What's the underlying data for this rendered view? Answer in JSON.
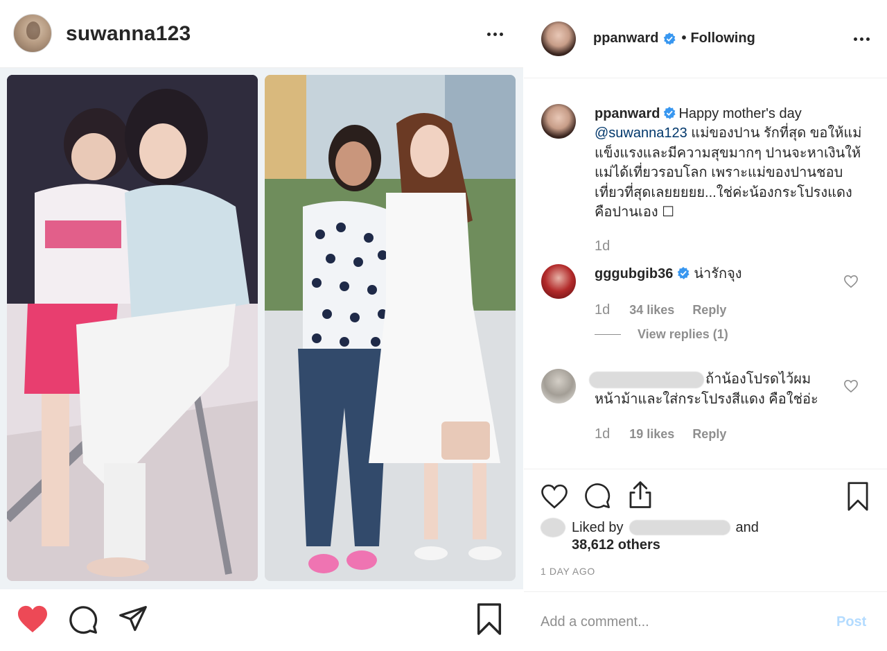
{
  "left_post": {
    "username": "suwanna123",
    "more_label": "More options"
  },
  "right_panel": {
    "header": {
      "username": "ppanward",
      "separator": "•",
      "follow_status": "Following"
    },
    "caption": {
      "username": "ppanward",
      "text_start": "Happy mother's day",
      "mention": "@suwanna123",
      "text_rest": "แม่ของปาน รักที่สุด ขอให้แม่แข็งแรงและมีความสุขมากๆ ปานจะหาเงินให้แม่ได้เที่ยวรอบโลก เพราะแม่ของปานชอบเที่ยวที่สุดเลยยยยย...ใช่ค่ะน้องกระโปรงแดงคือปานเอง ☐",
      "time": "1d"
    },
    "comments": [
      {
        "username": "gggubgib36",
        "text": "น่ารักจุง",
        "time": "1d",
        "likes": "34 likes",
        "reply": "Reply",
        "view_replies": "View replies (1)"
      },
      {
        "text_line1": "ถ้าน้องโปรดไว้ผม",
        "text_line2": "หน้าม้าและใส่กระโปรงสีแดง คือใช่อ่ะ",
        "time": "1d",
        "likes": "19 likes",
        "reply": "Reply"
      }
    ],
    "likes": {
      "prefix": "Liked by",
      "suffix": "and",
      "count": "38,612 others"
    },
    "date": "1 DAY AGO",
    "comment_input": {
      "placeholder": "Add a comment..."
    },
    "post_label": "Post"
  },
  "colors": {
    "like_red": "#ed4956",
    "verified_blue": "#3897f0",
    "text": "#262626",
    "muted": "#8e8e8e",
    "post_disabled": "#b3dbff"
  }
}
